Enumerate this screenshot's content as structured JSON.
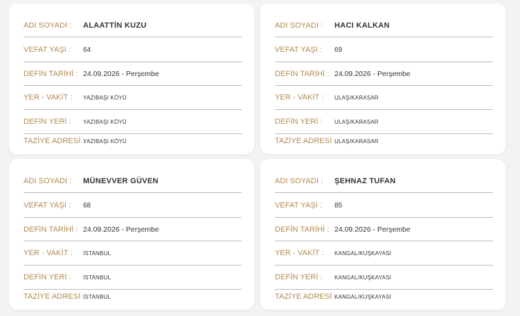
{
  "labels": {
    "name": "ADI SOYADI :",
    "age": "VEFAT YAŞI :",
    "burial_date": "DEFİN TARİHİ :",
    "place_time": "YER - VAKİT :",
    "burial_place": "DEFİN YERİ :",
    "condolence_address": "TAZİYE ADRESİ :"
  },
  "colors": {
    "label": "#b0894e",
    "value": "#333333",
    "card": "#ffffff",
    "background": "#f3f3f3",
    "divider": "#b9b9b9"
  },
  "cards": [
    {
      "name": "ALAATTİN KUZU",
      "age": "64",
      "burial_date": "24.09.2026 - Perşembe",
      "place_time": "YAZIBAŞI KÖYÜ",
      "burial_place": "YAZIBAŞI KÖYÜ",
      "condolence_address": "YAZIBAŞI KÖYÜ"
    },
    {
      "name": "HACI KALKAN",
      "age": "69",
      "burial_date": "24.09.2026 - Perşembe",
      "place_time": "ULAŞ/KARASAR",
      "burial_place": "ULAŞ/KARASAR",
      "condolence_address": "ULAŞ/KARASAR"
    },
    {
      "name": "MÜNEVVER GÜVEN",
      "age": "68",
      "burial_date": "24.09.2026 - Perşembe",
      "place_time": "İSTANBUL",
      "burial_place": "İSTANBUL",
      "condolence_address": "İSTANBUL"
    },
    {
      "name": "ŞEHNAZ TUFAN",
      "age": "85",
      "burial_date": "24.09.2026 - Perşembe",
      "place_time": "KANGAL/KUŞKAYASI",
      "burial_place": "KANGAL/KUŞKAYASI",
      "condolence_address": "KANGAL/KUŞKAYASI"
    }
  ]
}
